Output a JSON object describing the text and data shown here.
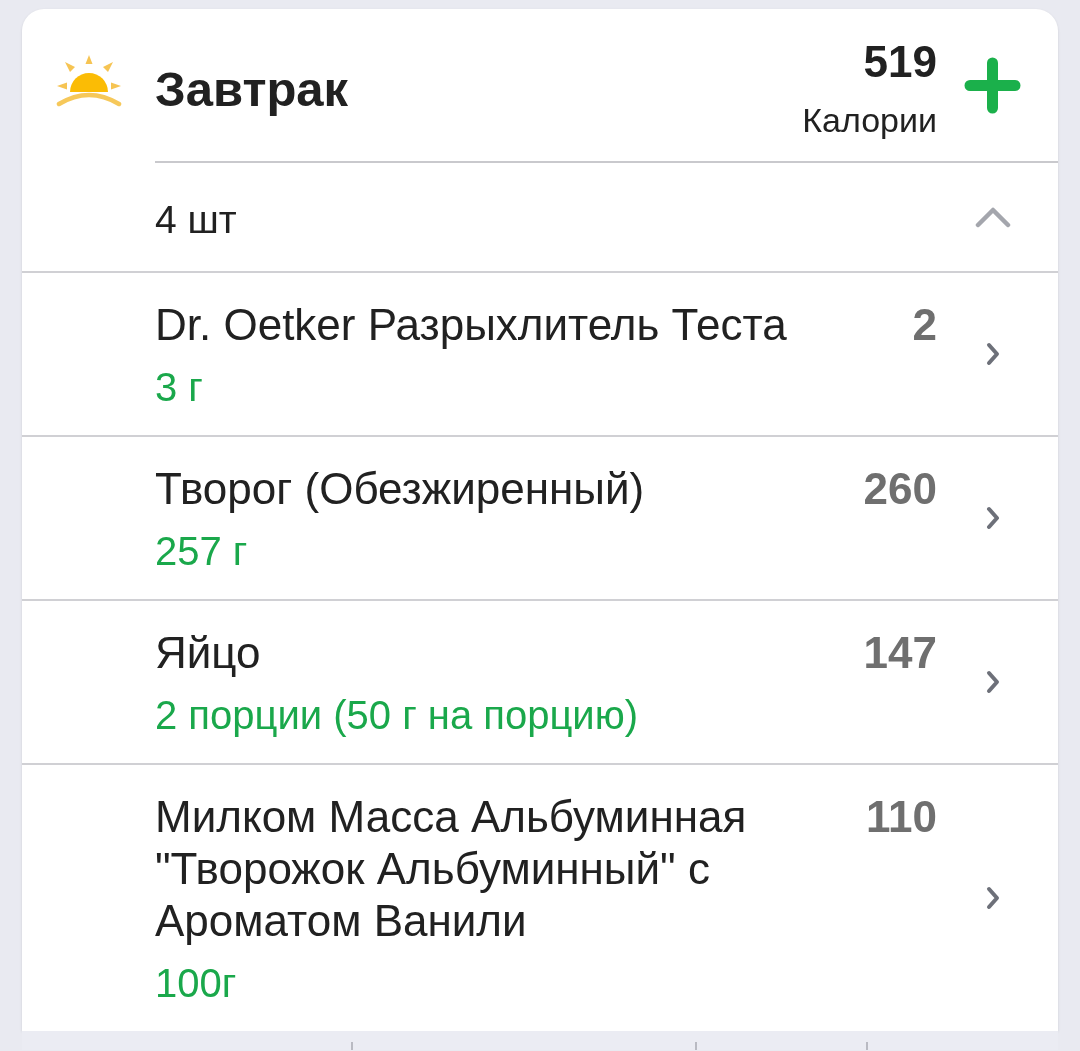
{
  "meal": {
    "title": "Завтрак",
    "calories": "519",
    "calories_label": "Калории"
  },
  "summary": {
    "count": "4 шт",
    "expanded": true
  },
  "items": [
    {
      "name": "Dr. Oetker Разрыхлитель Теста",
      "amount": "3 г",
      "calories": "2"
    },
    {
      "name": "Творог (Обезжиренный)",
      "amount": "257 г",
      "calories": "260"
    },
    {
      "name": "Яйцо",
      "amount": "2 порции (50 г на порцию)",
      "calories": "147"
    },
    {
      "name": "Милком Масса Альбуминная \"Творожок Альбуминный\" с Ароматом Ванили",
      "amount": "100г",
      "calories": "110"
    }
  ]
}
